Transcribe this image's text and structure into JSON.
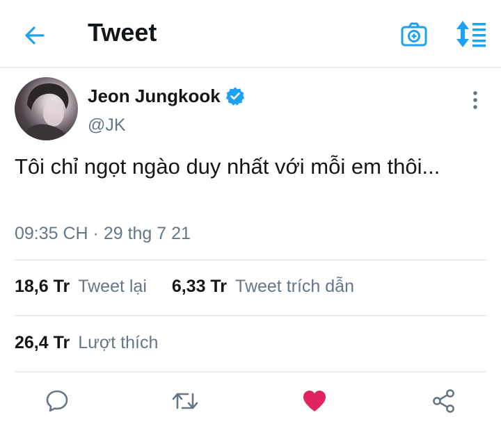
{
  "header": {
    "title": "Tweet"
  },
  "user": {
    "display_name": "Jeon Jungkook",
    "handle": "@JK",
    "verified": true
  },
  "tweet": {
    "text": "Tôi chỉ ngọt ngào duy nhất với mỗi em thôi...",
    "timestamp": "09:35 CH · 29 thg 7 21"
  },
  "stats": {
    "retweets_count": "18,6 Tr",
    "retweets_label": "Tweet lại",
    "quotes_count": "6,33 Tr",
    "quotes_label": "Tweet trích dẫn",
    "likes_count": "26,4 Tr",
    "likes_label": "Lượt thích"
  },
  "colors": {
    "accent": "#1da1f2",
    "like": "#e0245e",
    "muted": "#657786",
    "text": "#14171a",
    "divider": "#e6ecf0"
  },
  "icons": {
    "back": "arrow-left-icon",
    "camera": "camera-icon",
    "sort": "sort-icon",
    "verified": "verified-badge-icon",
    "more": "more-vertical-icon",
    "reply": "reply-icon",
    "retweet": "retweet-icon",
    "like": "heart-icon",
    "share": "share-icon"
  },
  "state": {
    "liked": true
  }
}
